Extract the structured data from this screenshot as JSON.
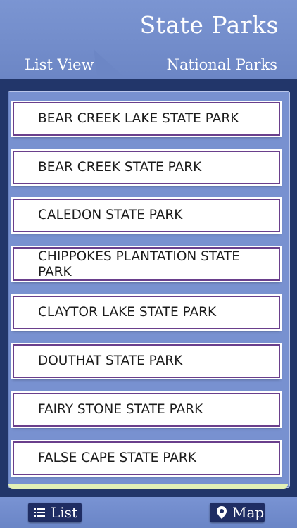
{
  "header": {
    "title": "State Parks",
    "tabs": [
      {
        "label": "List View"
      },
      {
        "label": "National Parks"
      }
    ]
  },
  "parks": [
    {
      "name": "BEAR CREEK LAKE STATE PARK"
    },
    {
      "name": "BEAR CREEK STATE PARK"
    },
    {
      "name": "CALEDON STATE PARK"
    },
    {
      "name": "CHIPPOKES PLANTATION STATE PARK"
    },
    {
      "name": "CLAYTOR LAKE STATE PARK"
    },
    {
      "name": "DOUTHAT STATE PARK"
    },
    {
      "name": "FAIRY STONE STATE PARK"
    },
    {
      "name": "FALSE CAPE STATE PARK"
    }
  ],
  "bottom_bar": {
    "list_label": "List",
    "list_icon": "list-icon",
    "map_label": "Map",
    "map_icon": "map-pin-icon"
  },
  "colors": {
    "header": "#6c86c5",
    "background": "#22366a",
    "button": "#1f2d63",
    "row_border": "#6a3f8c"
  }
}
